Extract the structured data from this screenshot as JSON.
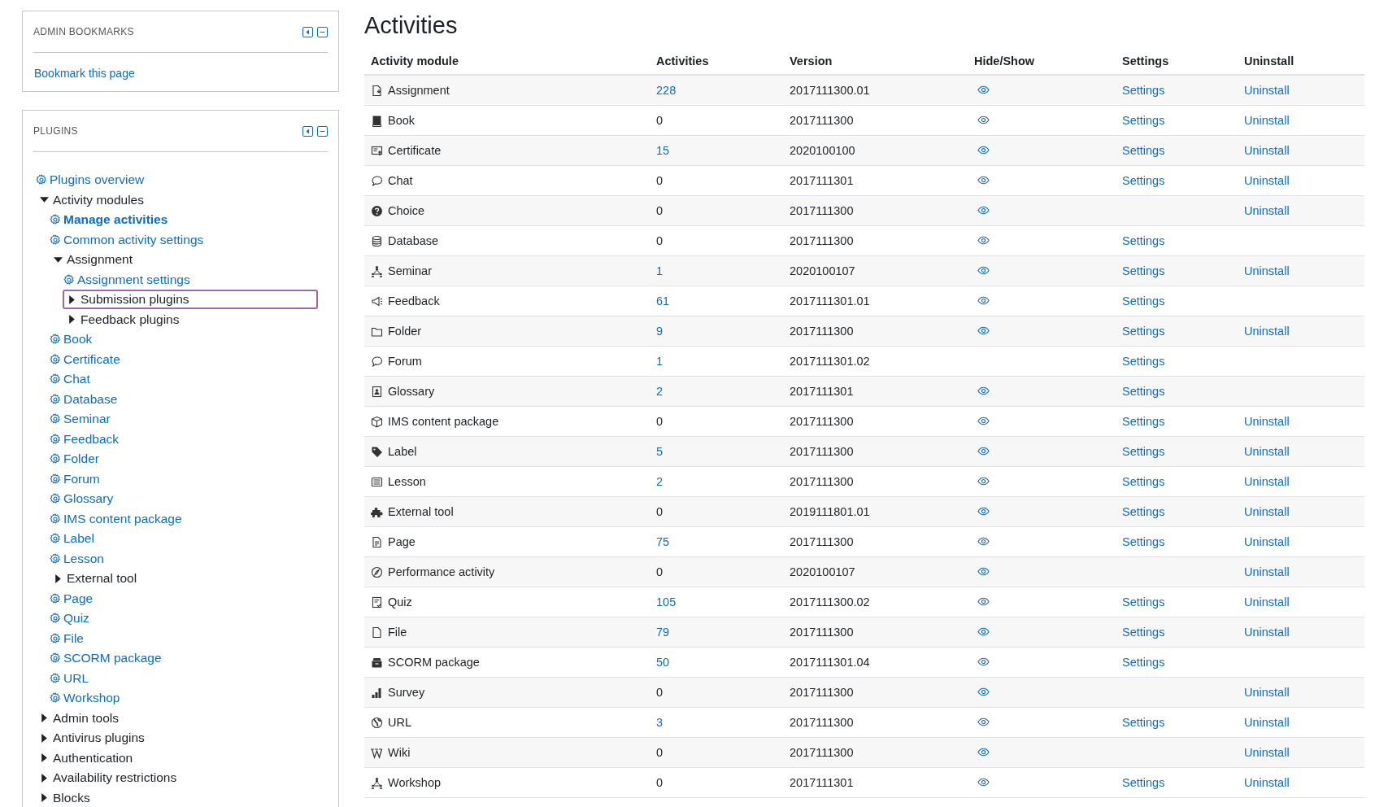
{
  "bookmarks": {
    "title": "ADMIN BOOKMARKS",
    "link": "Bookmark this page"
  },
  "plugins": {
    "title": "PLUGINS",
    "tree": [
      {
        "kind": "link",
        "label": "Plugins overview",
        "selected": false
      },
      {
        "kind": "folder",
        "label": "Activity modules",
        "expanded": true,
        "focused": false,
        "children": [
          {
            "kind": "link",
            "label": "Manage activities",
            "selected": true
          },
          {
            "kind": "link",
            "label": "Common activity settings",
            "selected": false
          },
          {
            "kind": "folder",
            "label": "Assignment",
            "expanded": true,
            "focused": false,
            "children": [
              {
                "kind": "link",
                "label": "Assignment settings",
                "selected": false
              },
              {
                "kind": "folder",
                "label": "Submission plugins",
                "expanded": false,
                "focused": true
              },
              {
                "kind": "folder",
                "label": "Feedback plugins",
                "expanded": false,
                "focused": false
              }
            ]
          },
          {
            "kind": "link",
            "label": "Book",
            "selected": false
          },
          {
            "kind": "link",
            "label": "Certificate",
            "selected": false
          },
          {
            "kind": "link",
            "label": "Chat",
            "selected": false
          },
          {
            "kind": "link",
            "label": "Database",
            "selected": false
          },
          {
            "kind": "link",
            "label": "Seminar",
            "selected": false
          },
          {
            "kind": "link",
            "label": "Feedback",
            "selected": false
          },
          {
            "kind": "link",
            "label": "Folder",
            "selected": false
          },
          {
            "kind": "link",
            "label": "Forum",
            "selected": false
          },
          {
            "kind": "link",
            "label": "Glossary",
            "selected": false
          },
          {
            "kind": "link",
            "label": "IMS content package",
            "selected": false
          },
          {
            "kind": "link",
            "label": "Label",
            "selected": false
          },
          {
            "kind": "link",
            "label": "Lesson",
            "selected": false
          },
          {
            "kind": "folder",
            "label": "External tool",
            "expanded": false,
            "focused": false
          },
          {
            "kind": "link",
            "label": "Page",
            "selected": false
          },
          {
            "kind": "link",
            "label": "Quiz",
            "selected": false
          },
          {
            "kind": "link",
            "label": "File",
            "selected": false
          },
          {
            "kind": "link",
            "label": "SCORM package",
            "selected": false
          },
          {
            "kind": "link",
            "label": "URL",
            "selected": false
          },
          {
            "kind": "link",
            "label": "Workshop",
            "selected": false
          }
        ]
      },
      {
        "kind": "folder",
        "label": "Admin tools",
        "expanded": false,
        "focused": false
      },
      {
        "kind": "folder",
        "label": "Antivirus plugins",
        "expanded": false,
        "focused": false
      },
      {
        "kind": "folder",
        "label": "Authentication",
        "expanded": false,
        "focused": false
      },
      {
        "kind": "folder",
        "label": "Availability restrictions",
        "expanded": false,
        "focused": false
      },
      {
        "kind": "folder",
        "label": "Blocks",
        "expanded": false,
        "focused": false
      }
    ]
  },
  "page_title": "Activities",
  "table": {
    "columns": [
      "Activity module",
      "Activities",
      "Version",
      "Hide/Show",
      "Settings",
      "Uninstall"
    ],
    "rows": [
      {
        "name": "Assignment",
        "count": "228",
        "count_link": true,
        "version": "2017111300.01",
        "visible": true,
        "settings": "Settings",
        "uninstall": "Uninstall"
      },
      {
        "name": "Book",
        "count": "0",
        "count_link": false,
        "version": "2017111300",
        "visible": true,
        "settings": "Settings",
        "uninstall": "Uninstall"
      },
      {
        "name": "Certificate",
        "count": "15",
        "count_link": true,
        "version": "2020100100",
        "visible": true,
        "settings": "Settings",
        "uninstall": "Uninstall"
      },
      {
        "name": "Chat",
        "count": "0",
        "count_link": false,
        "version": "2017111301",
        "visible": true,
        "settings": "Settings",
        "uninstall": "Uninstall"
      },
      {
        "name": "Choice",
        "count": "0",
        "count_link": false,
        "version": "2017111300",
        "visible": true,
        "uninstall": "Uninstall"
      },
      {
        "name": "Database",
        "count": "0",
        "count_link": false,
        "version": "2017111300",
        "visible": true,
        "settings": "Settings"
      },
      {
        "name": "Seminar",
        "count": "1",
        "count_link": true,
        "version": "2020100107",
        "visible": true,
        "settings": "Settings",
        "uninstall": "Uninstall"
      },
      {
        "name": "Feedback",
        "count": "61",
        "count_link": true,
        "version": "2017111301.01",
        "visible": true,
        "settings": "Settings"
      },
      {
        "name": "Folder",
        "count": "9",
        "count_link": true,
        "version": "2017111300",
        "visible": true,
        "settings": "Settings",
        "uninstall": "Uninstall"
      },
      {
        "name": "Forum",
        "count": "1",
        "count_link": true,
        "version": "2017111301.02",
        "visible": false,
        "settings": "Settings"
      },
      {
        "name": "Glossary",
        "count": "2",
        "count_link": true,
        "version": "2017111301",
        "visible": true,
        "settings": "Settings"
      },
      {
        "name": "IMS content package",
        "count": "0",
        "count_link": false,
        "version": "2017111300",
        "visible": true,
        "settings": "Settings",
        "uninstall": "Uninstall"
      },
      {
        "name": "Label",
        "count": "5",
        "count_link": true,
        "version": "2017111300",
        "visible": true,
        "settings": "Settings",
        "uninstall": "Uninstall"
      },
      {
        "name": "Lesson",
        "count": "2",
        "count_link": true,
        "version": "2017111300",
        "visible": true,
        "settings": "Settings",
        "uninstall": "Uninstall"
      },
      {
        "name": "External tool",
        "count": "0",
        "count_link": false,
        "version": "2019111801.01",
        "visible": true,
        "settings": "Settings",
        "uninstall": "Uninstall"
      },
      {
        "name": "Page",
        "count": "75",
        "count_link": true,
        "version": "2017111300",
        "visible": true,
        "settings": "Settings",
        "uninstall": "Uninstall"
      },
      {
        "name": "Performance activity",
        "count": "0",
        "count_link": false,
        "version": "2020100107",
        "visible": true,
        "uninstall": "Uninstall"
      },
      {
        "name": "Quiz",
        "count": "105",
        "count_link": true,
        "version": "2017111300.02",
        "visible": true,
        "settings": "Settings",
        "uninstall": "Uninstall"
      },
      {
        "name": "File",
        "count": "79",
        "count_link": true,
        "version": "2017111300",
        "visible": true,
        "settings": "Settings",
        "uninstall": "Uninstall"
      },
      {
        "name": "SCORM package",
        "count": "50",
        "count_link": true,
        "version": "2017111301.04",
        "visible": true,
        "settings": "Settings"
      },
      {
        "name": "Survey",
        "count": "0",
        "count_link": false,
        "version": "2017111300",
        "visible": true,
        "uninstall": "Uninstall"
      },
      {
        "name": "URL",
        "count": "3",
        "count_link": true,
        "version": "2017111300",
        "visible": true,
        "settings": "Settings",
        "uninstall": "Uninstall"
      },
      {
        "name": "Wiki",
        "count": "0",
        "count_link": false,
        "version": "2017111300",
        "visible": true,
        "uninstall": "Uninstall"
      },
      {
        "name": "Workshop",
        "count": "0",
        "count_link": false,
        "version": "2017111301",
        "visible": true,
        "settings": "Settings",
        "uninstall": "Uninstall"
      }
    ]
  }
}
